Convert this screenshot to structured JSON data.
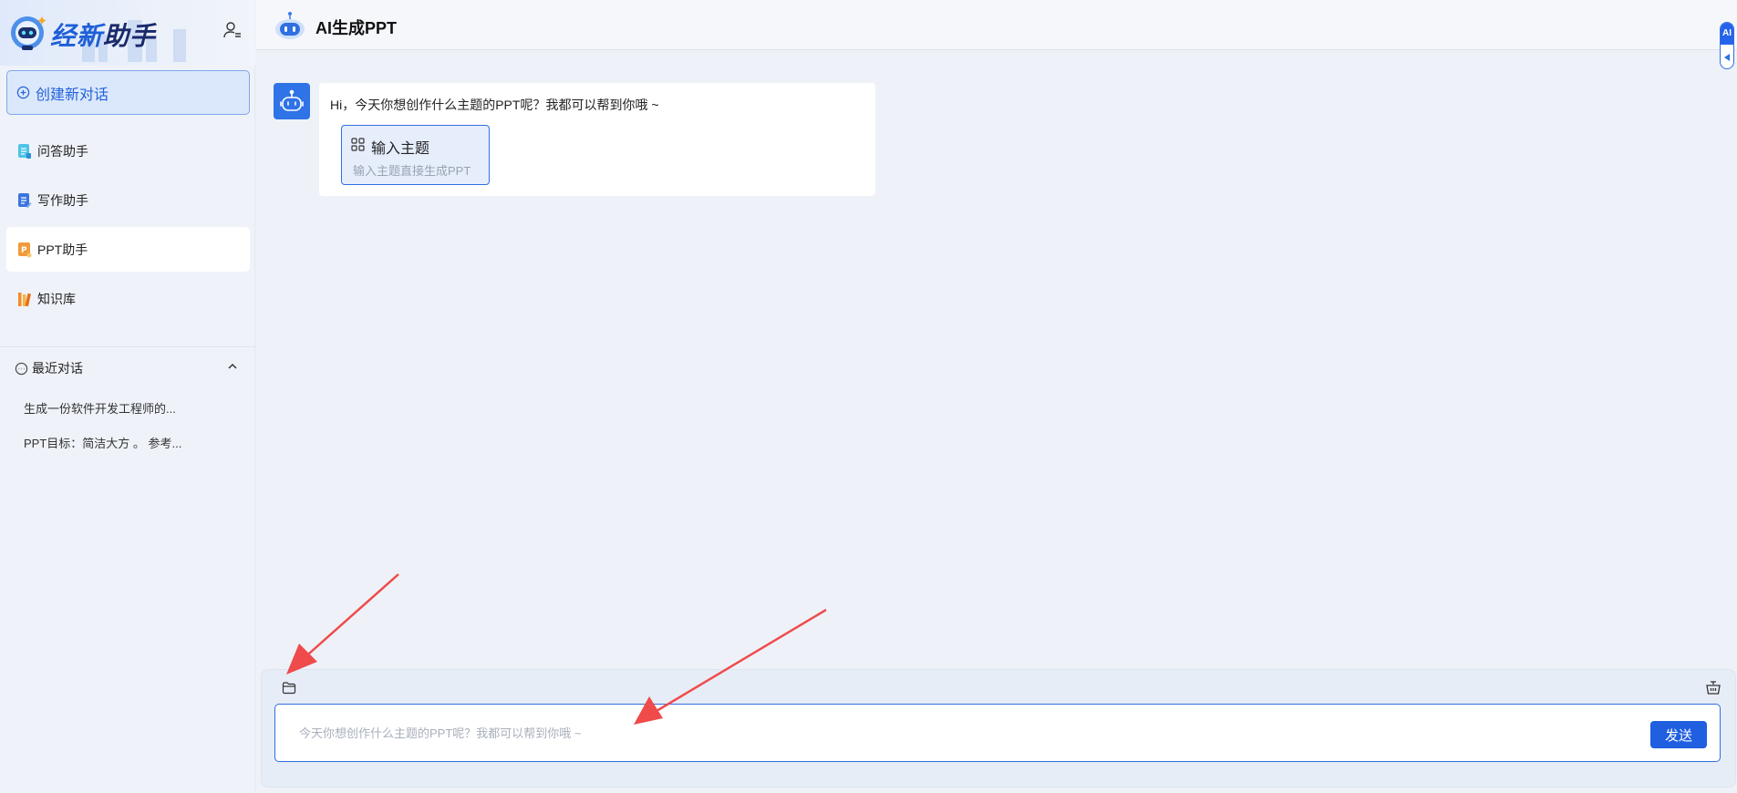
{
  "brand": {
    "name_part1": "经新",
    "name_part2": "助手"
  },
  "sidebar": {
    "new_chat_label": "创建新对话",
    "items": [
      {
        "label": "问答助手",
        "icon": "doc-cyan-icon"
      },
      {
        "label": "写作助手",
        "icon": "doc-blue-icon"
      },
      {
        "label": "PPT助手",
        "icon": "ppt-icon",
        "active": true
      },
      {
        "label": "知识库",
        "icon": "library-icon"
      }
    ],
    "recent_title": "最近对话",
    "recent": [
      "生成一份软件开发工程师的...",
      "PPT目标：简洁大方 。 参考..."
    ]
  },
  "header": {
    "title": "AI生成PPT"
  },
  "side_tab": {
    "label": "AI"
  },
  "chat": {
    "greeting": "Hi，今天你想创作什么主题的PPT呢？我都可以帮到你哦 ~",
    "card_title": "输入主题",
    "card_desc": "输入主题直接生成PPT"
  },
  "composer": {
    "placeholder": "今天你想创作什么主题的PPT呢？我都可以帮到你哦 ~",
    "value": "",
    "send_label": "发送"
  },
  "colors": {
    "accent": "#1f5fe0",
    "annotation": "#ef4b4b"
  }
}
